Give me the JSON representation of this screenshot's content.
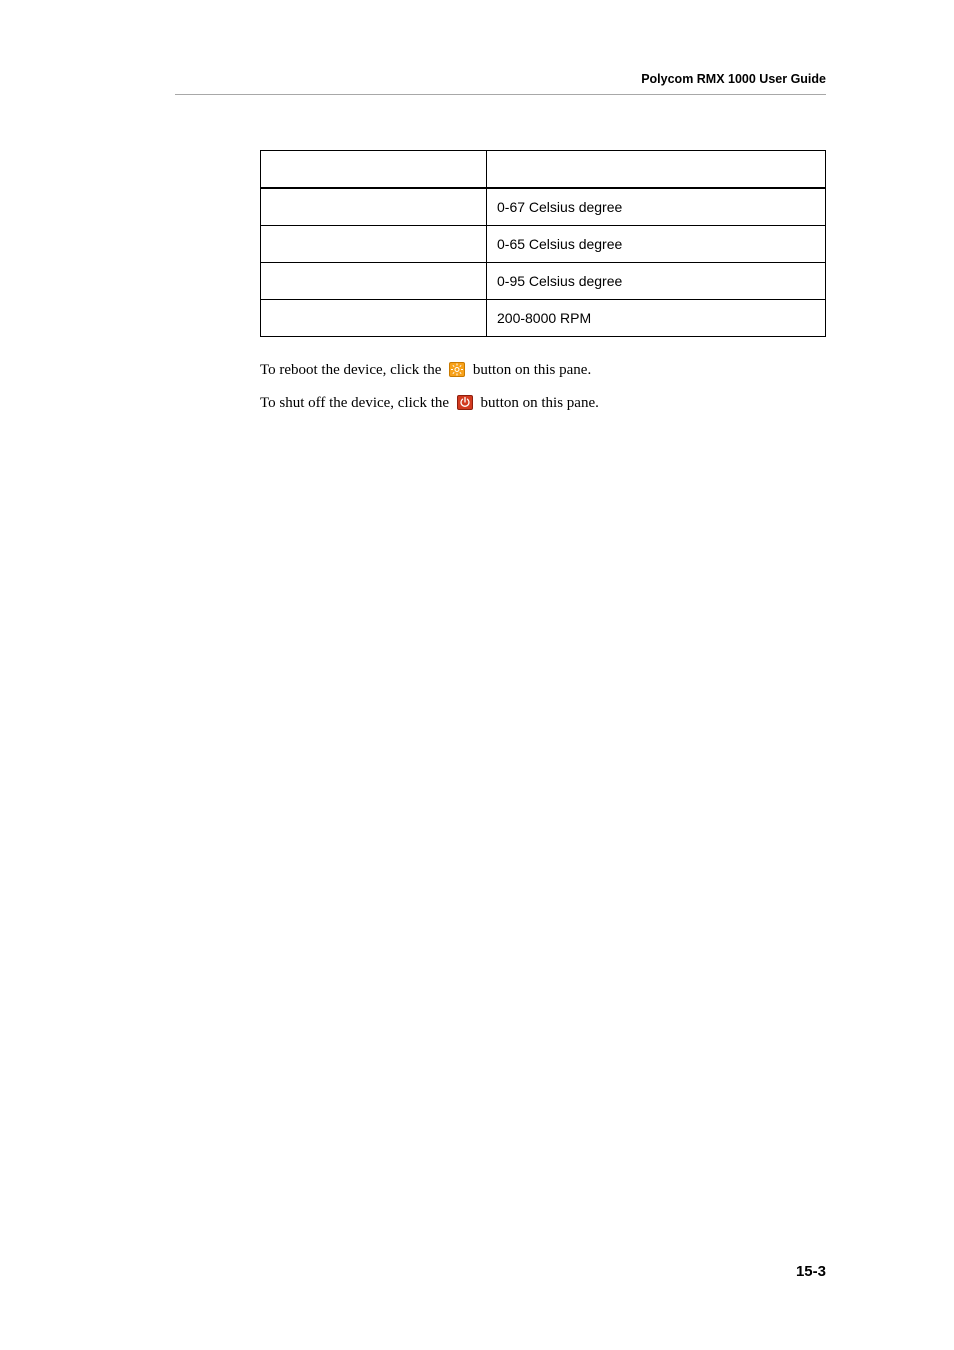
{
  "header": {
    "guide_title": "Polycom RMX 1000 User Guide"
  },
  "table": {
    "headers": [
      "",
      ""
    ],
    "rows": [
      [
        "",
        "0-67 Celsius degree"
      ],
      [
        "",
        "0-65 Celsius degree"
      ],
      [
        "",
        "0-95 Celsius degree"
      ],
      [
        "",
        "200-8000 RPM"
      ]
    ]
  },
  "paragraphs": {
    "p1_a": "To reboot the device, click the ",
    "p1_b": " button on this pane.",
    "p2_a": "To shut off the device, click the ",
    "p2_b": " button on this pane."
  },
  "footer": {
    "page_number": "15-3"
  }
}
